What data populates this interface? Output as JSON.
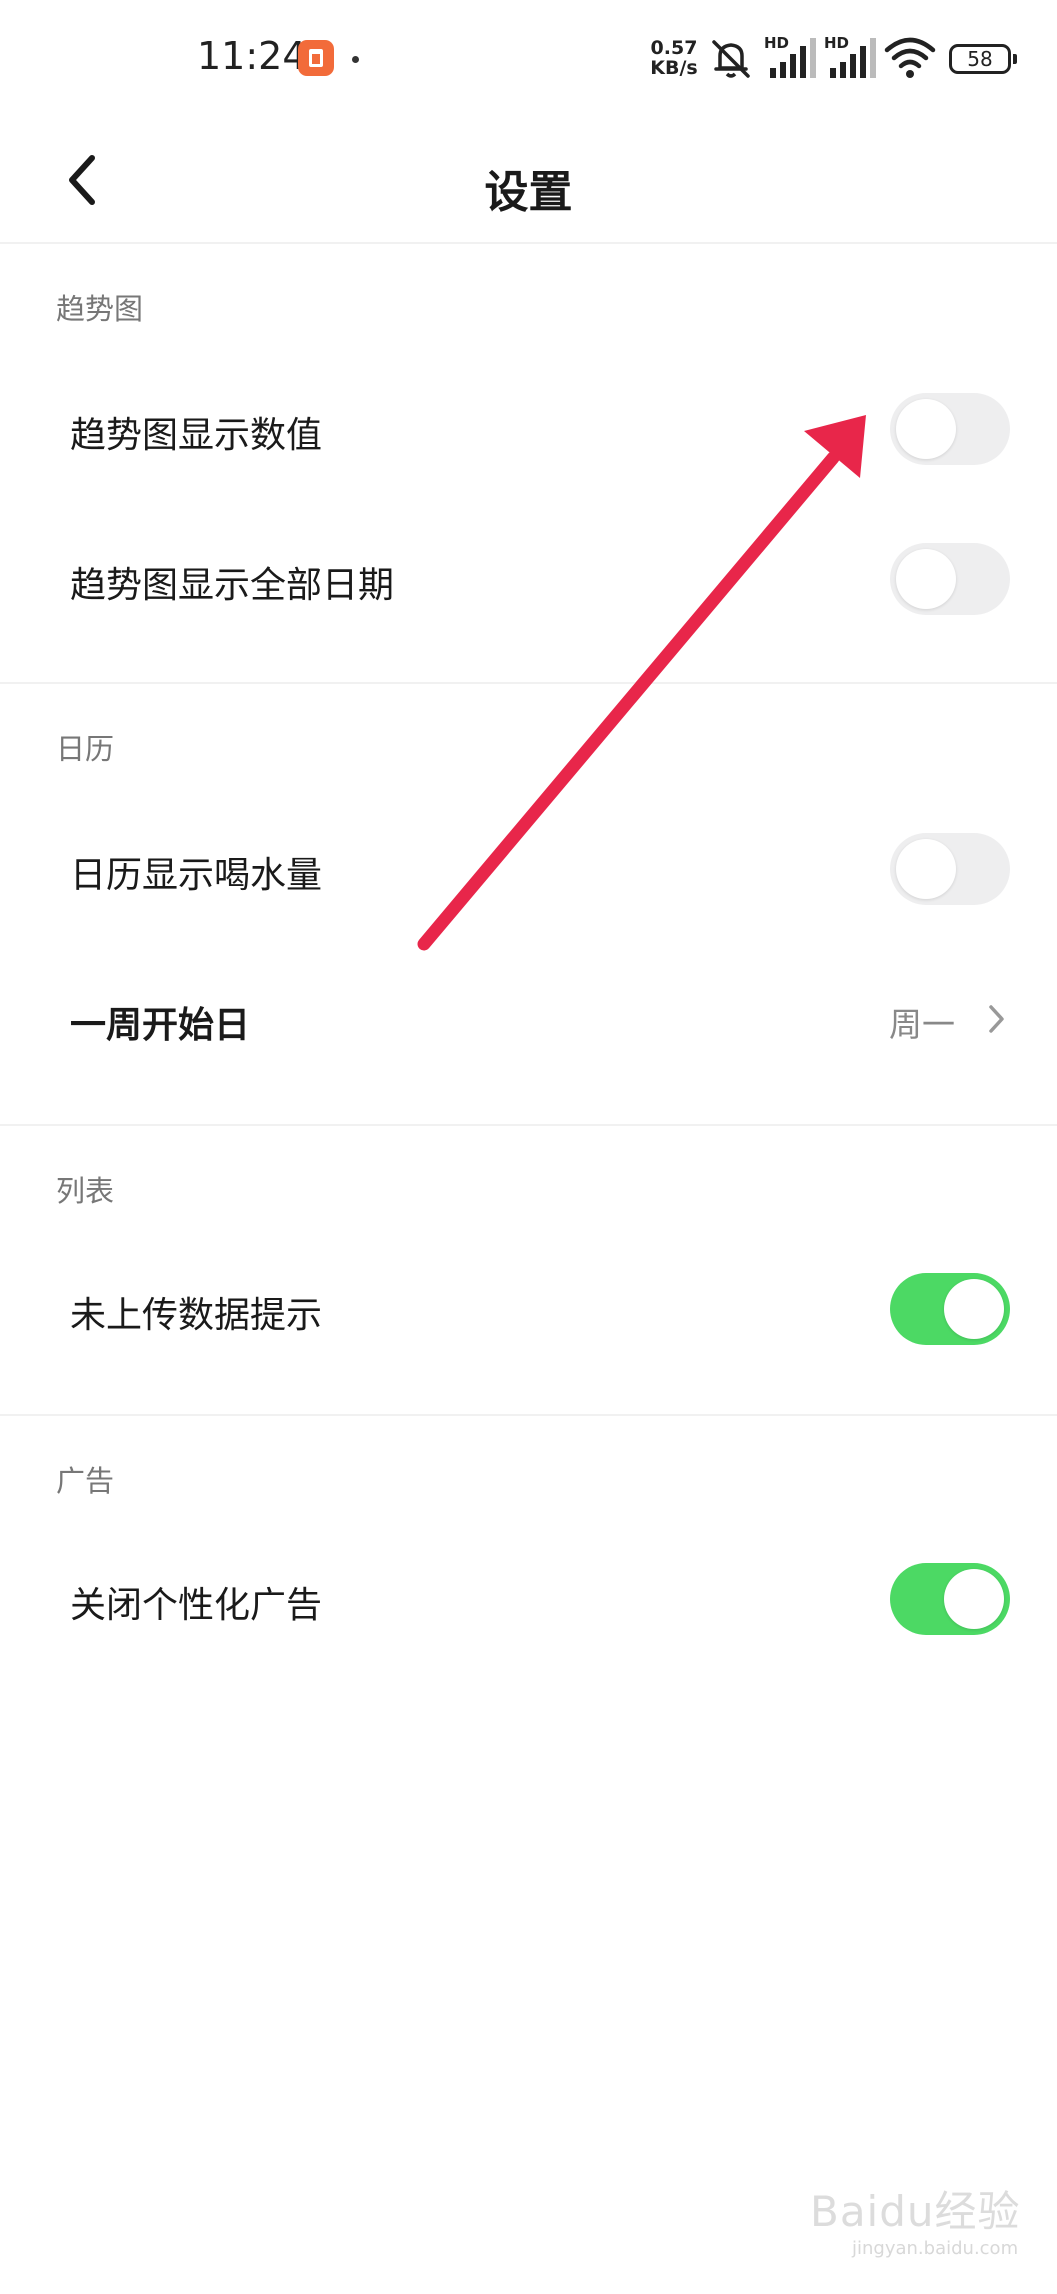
{
  "status_bar": {
    "time": "11:24",
    "net_speed_value": "0.57",
    "net_speed_unit": "KB/s",
    "signal1_label": "HD",
    "signal2_label": "HD",
    "battery": "58",
    "icons": [
      "app-notification-icon",
      "mute-icon",
      "signal-icon",
      "wifi-icon",
      "battery-icon"
    ]
  },
  "header": {
    "title": "设置",
    "back_icon": "chevron-left-icon"
  },
  "sections": {
    "trend": {
      "title": "趋势图",
      "items": [
        {
          "label": "趋势图显示数值",
          "toggle_on": false
        },
        {
          "label": "趋势图显示全部日期",
          "toggle_on": false
        }
      ]
    },
    "calendar": {
      "title": "日历",
      "items": [
        {
          "label": "日历显示喝水量",
          "toggle_on": false
        },
        {
          "label": "一周开始日",
          "value": "周一"
        }
      ]
    },
    "list": {
      "title": "列表",
      "items": [
        {
          "label": "未上传数据提示",
          "toggle_on": true
        }
      ]
    },
    "ads": {
      "title": "广告",
      "items": [
        {
          "label": "关闭个性化广告",
          "toggle_on": true
        }
      ]
    }
  },
  "colors": {
    "toggle_on": "#4cd964",
    "toggle_off": "#eeeeef",
    "annotation_arrow": "#e8264a"
  },
  "watermark": {
    "brand": "Baidu经验",
    "url": "jingyan.baidu.com"
  }
}
